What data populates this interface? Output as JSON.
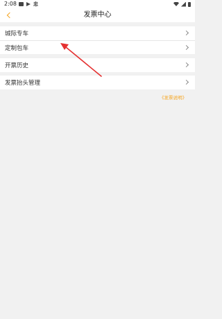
{
  "status_bar": {
    "time": "2:08",
    "icons": [
      "image-icon",
      "play-store-icon",
      "app-icon",
      "wifi-icon",
      "signal-icon",
      "battery-icon"
    ],
    "app_glyph": "忠"
  },
  "header": {
    "title": "发票中心",
    "back_icon": "chevron-left-icon"
  },
  "menu": {
    "group1": [
      {
        "label": "城际专车"
      },
      {
        "label": "定制包车"
      }
    ],
    "group2": [
      {
        "label": "开票历史"
      }
    ],
    "group3": [
      {
        "label": "发票抬头管理"
      }
    ]
  },
  "note": {
    "label": "《发票说明》"
  },
  "colors": {
    "accent": "#f5a623",
    "background": "#f1f1f1",
    "annotation": "#e53030"
  }
}
